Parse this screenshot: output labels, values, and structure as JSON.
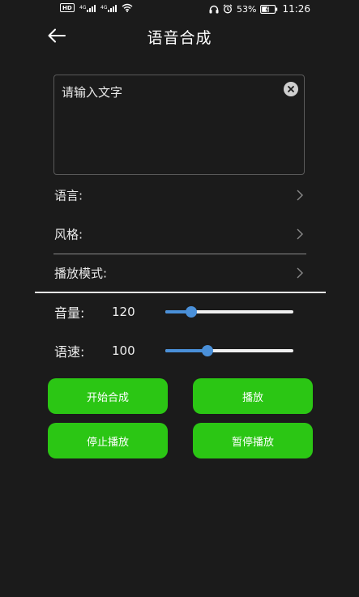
{
  "status_bar": {
    "hd_label": "HD",
    "battery_percent": "53%",
    "time": "11:26"
  },
  "header": {
    "title": "语音合成"
  },
  "text_area": {
    "placeholder": "请输入文字"
  },
  "options": {
    "language_label": "语言:",
    "style_label": "风格:",
    "playback_mode_label": "播放模式:"
  },
  "sliders": {
    "volume": {
      "label": "音量:",
      "value": "120",
      "position": 0.2
    },
    "speed": {
      "label": "语速:",
      "value": "100",
      "position": 0.33
    }
  },
  "buttons": {
    "start_synthesis": "开始合成",
    "play": "播放",
    "stop_play": "停止播放",
    "pause_play": "暂停播放"
  },
  "colors": {
    "background": "#1b1b1b",
    "button_green": "#2bc614",
    "slider_blue": "#4a90d9"
  },
  "icons": {
    "back": "arrow-left-icon",
    "clear": "close-circle-icon",
    "chevron": "chevron-right-icon"
  }
}
